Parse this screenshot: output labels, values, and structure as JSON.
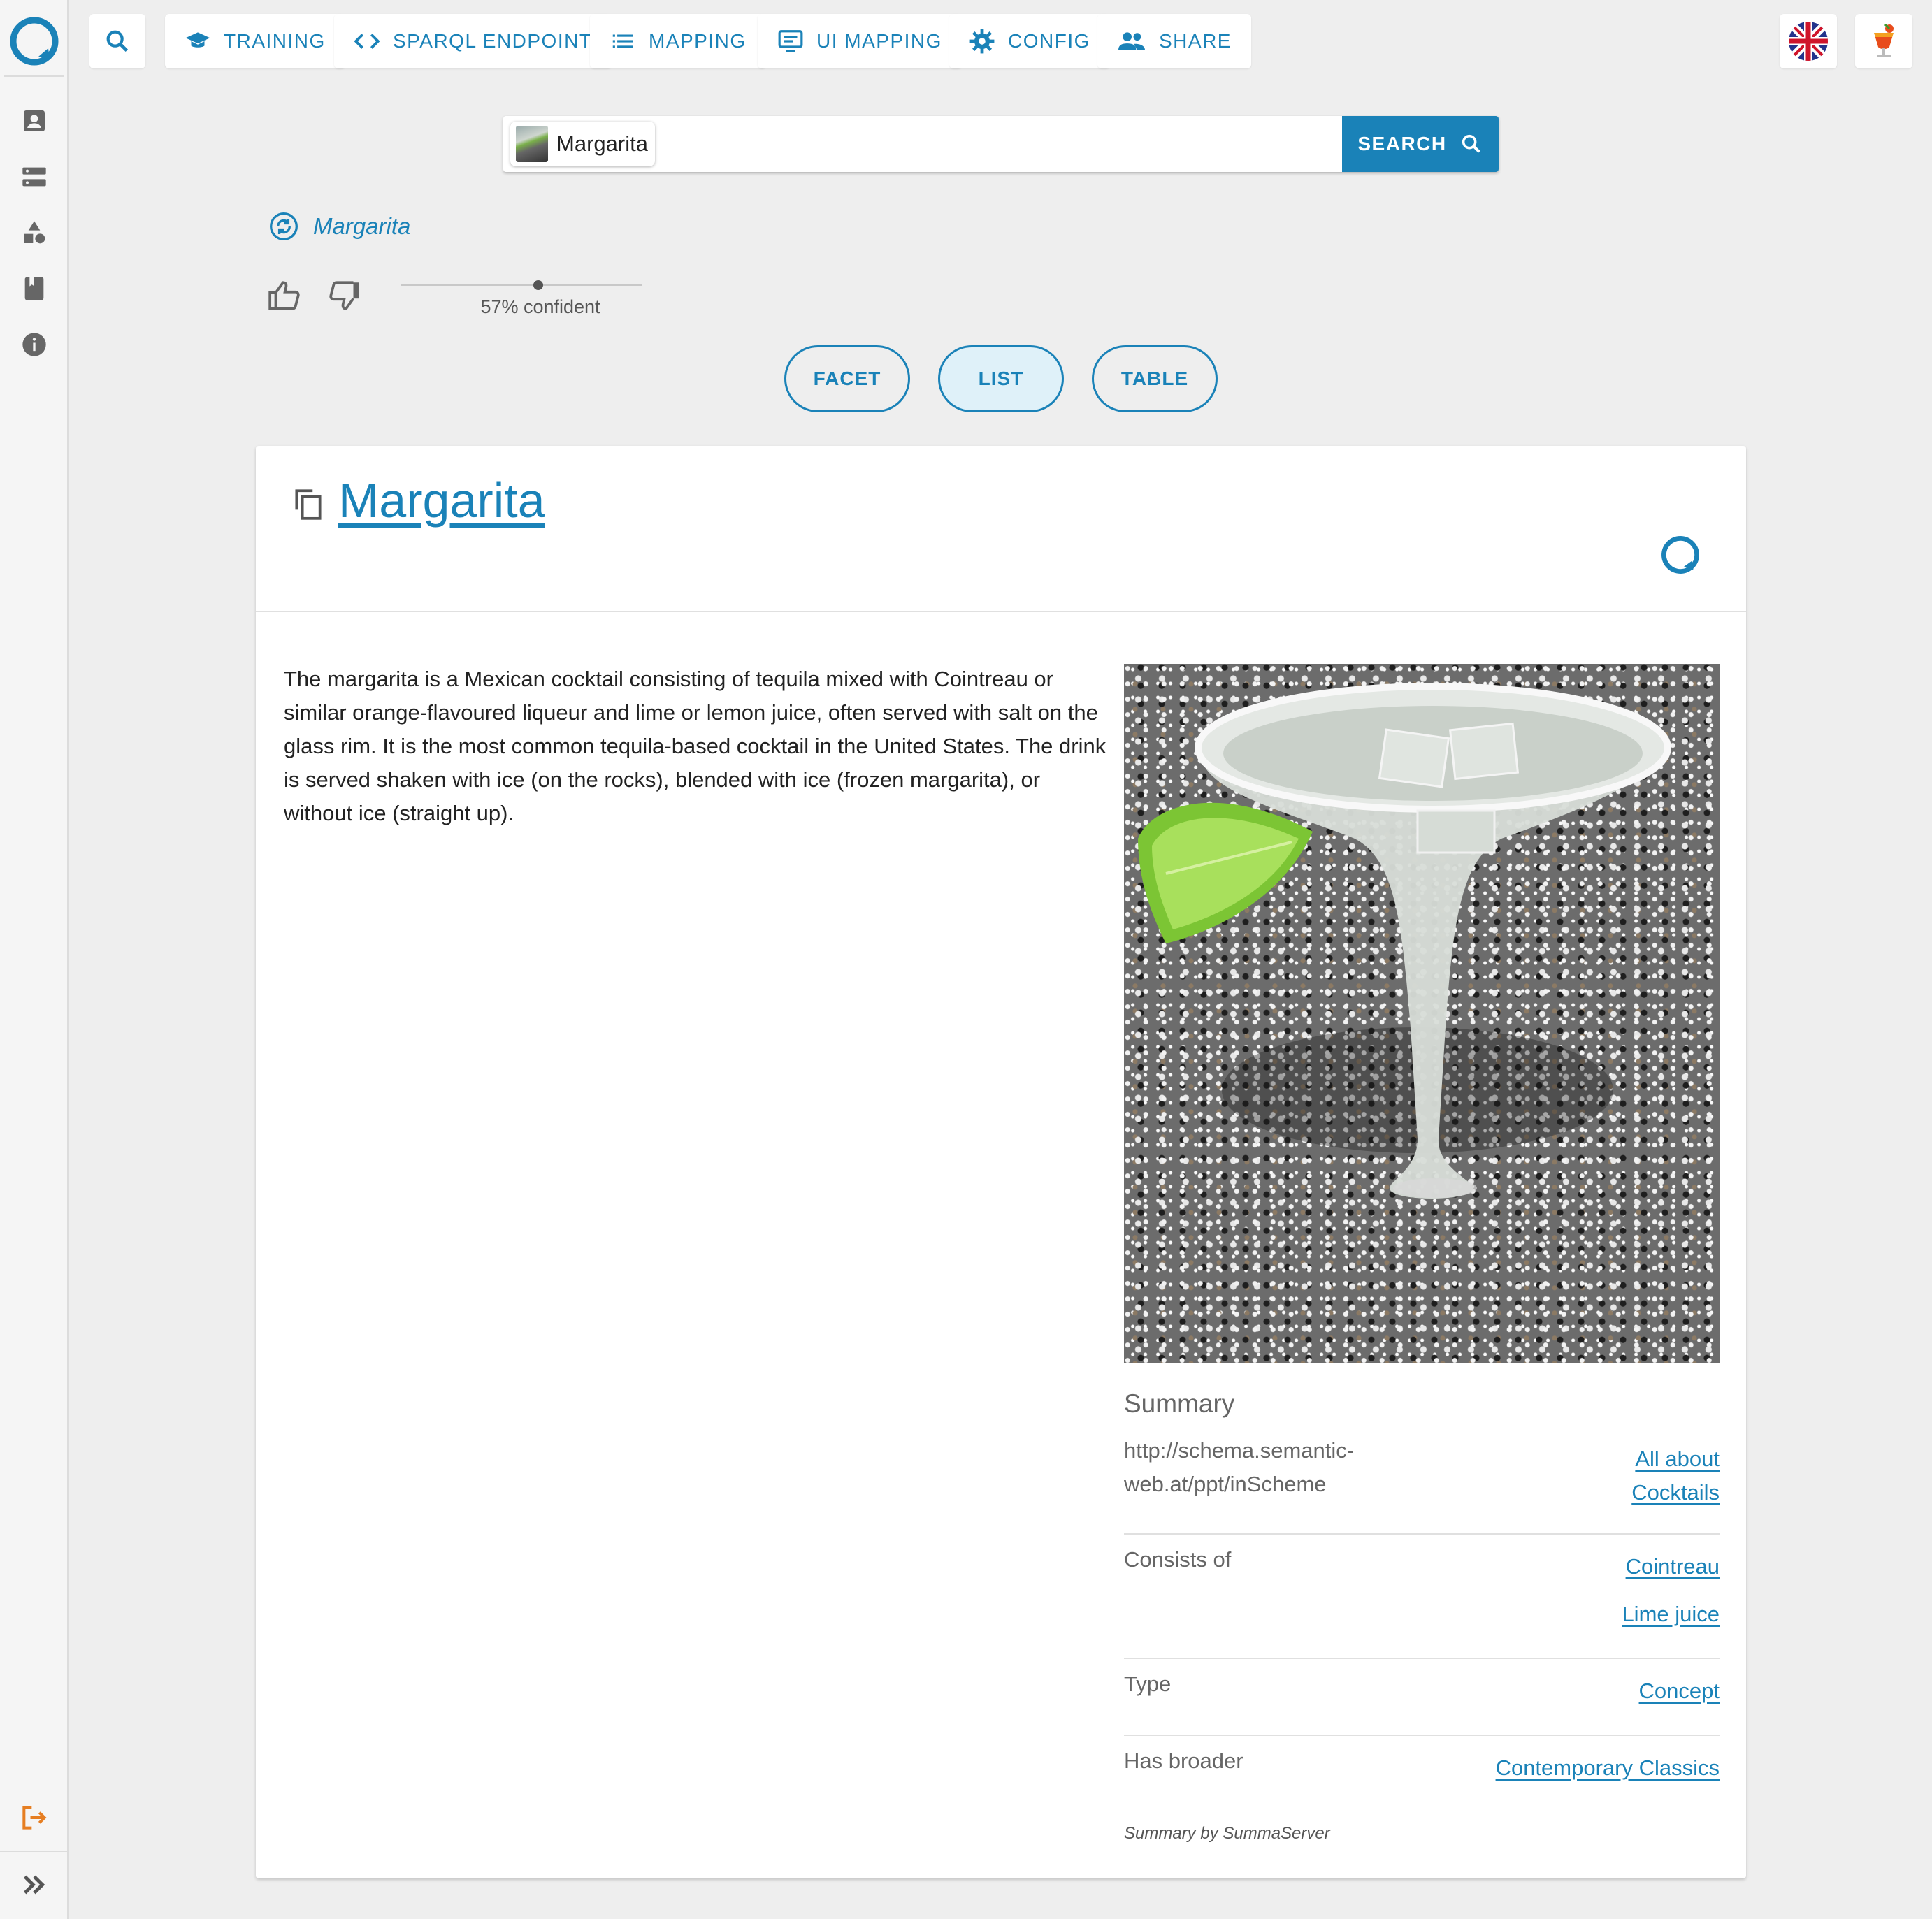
{
  "nav": {
    "training": "TRAINING",
    "sparql": "SPARQL ENDPOINT",
    "mapping": "MAPPING",
    "ui_mapping": "UI MAPPING",
    "config": "CONFIG",
    "share": "SHARE"
  },
  "rail_icons": [
    "logo-icon",
    "user-icon",
    "storage-icon",
    "shapes-icon",
    "book-icon",
    "info-icon",
    "logout-icon",
    "expand-icon"
  ],
  "search": {
    "chip_label": "Margarita",
    "button_label": "SEARCH"
  },
  "breadcrumb": {
    "label": "Margarita"
  },
  "confidence": {
    "value": 0.57,
    "label": "57% confident"
  },
  "views": {
    "facet": "FACET",
    "list": "LIST",
    "table": "TABLE",
    "active": "LIST"
  },
  "card": {
    "title": "Margarita",
    "abstract": "The margarita is a Mexican cocktail consisting of tequila mixed with Cointreau or similar orange-flavoured liqueur and lime or lemon juice, often served with salt on the glass rim. It is the most common tequila-based cocktail in the United States. The drink is served shaken with ice (on the rocks), blended with ice (frozen margarita), or without ice (straight up).",
    "summary": {
      "title": "Summary",
      "rows": [
        {
          "label": "http://schema.semantic-web.at/ppt/inScheme",
          "values": [
            "All about Cocktails"
          ]
        },
        {
          "label": "Consists of",
          "values": [
            "Cointreau",
            "Lime juice"
          ]
        },
        {
          "label": "Type",
          "values": [
            "Concept"
          ]
        },
        {
          "label": "Has broader",
          "values": [
            "Contemporary Classics"
          ]
        }
      ],
      "footer": "Summary by SummaServer"
    }
  },
  "colors": {
    "accent": "#1a82b8",
    "logout": "#e67e22"
  }
}
